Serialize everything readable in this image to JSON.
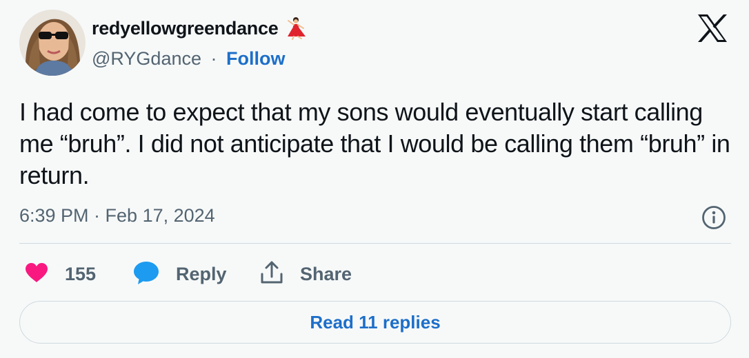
{
  "author": {
    "display_name": "redyellowgreendance",
    "name_emoji": "woman-dancing-emoji",
    "handle": "@RYGdance",
    "separator": "·",
    "follow_label": "Follow",
    "avatar": "profile-photo-woman-sunglasses"
  },
  "platform_logo": "x-logo",
  "tweet": {
    "text": "I had come to expect that my sons would eventually start calling me “bruh”. I did not anticipate that I would be calling them “bruh” in return.",
    "timestamp": "6:39 PM · Feb 17, 2024",
    "info_icon": "info-icon"
  },
  "actions": {
    "likes": "155",
    "reply_label": "Reply",
    "share_label": "Share"
  },
  "read_replies_label": "Read 11 replies",
  "colors": {
    "like": "#f91880",
    "reply": "#1d9bf0",
    "link": "#1d6fc9",
    "muted": "#536471",
    "background": "#f7f9f9"
  }
}
